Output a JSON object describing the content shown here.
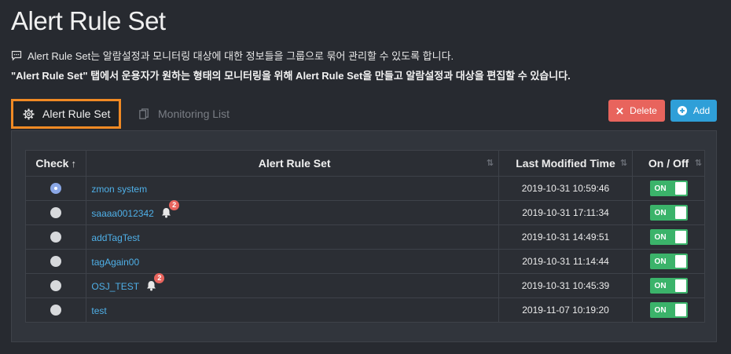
{
  "page": {
    "title": "Alert Rule Set",
    "description_line1": "Alert Rule Set는 알람설정과 모니터링 대상에 대한 정보들을 그룹으로 묶어 관리할 수 있도록 합니다.",
    "description_line2": "\"Alert Rule Set\" 탭에서 운용자가 원하는 형태의 모니터링을 위해 Alert Rule Set을 만들고 알람설정과 대상을 편집할 수 있습니다."
  },
  "tabs": [
    {
      "label": "Alert Rule Set",
      "icon": "gear-icon",
      "active": true
    },
    {
      "label": "Monitoring List",
      "icon": "copy-icon",
      "active": false
    }
  ],
  "toolbar": {
    "delete_label": "Delete",
    "add_label": "Add"
  },
  "table": {
    "headers": {
      "check": "Check",
      "name": "Alert Rule Set",
      "time": "Last Modified Time",
      "onoff": "On / Off"
    },
    "rows": [
      {
        "selected": true,
        "name": "zmon system",
        "badge": "",
        "time": "2019-10-31 10:59:46",
        "toggle": "ON"
      },
      {
        "selected": false,
        "name": "saaaa0012342",
        "badge": "2",
        "time": "2019-10-31 17:11:34",
        "toggle": "ON"
      },
      {
        "selected": false,
        "name": "addTagTest",
        "badge": "",
        "time": "2019-10-31 14:49:51",
        "toggle": "ON"
      },
      {
        "selected": false,
        "name": "tagAgain00",
        "badge": "",
        "time": "2019-10-31 11:14:44",
        "toggle": "ON"
      },
      {
        "selected": false,
        "name": "OSJ_TEST",
        "badge": "2",
        "time": "2019-10-31 10:45:39",
        "toggle": "ON"
      },
      {
        "selected": false,
        "name": "test",
        "badge": "",
        "time": "2019-11-07 10:19:20",
        "toggle": "ON"
      }
    ]
  },
  "colors": {
    "accent_tab_border": "#f08a24",
    "delete": "#e8645d",
    "add": "#2f9fd8",
    "toggle_on": "#3bb36a",
    "link": "#4fb0e8"
  }
}
